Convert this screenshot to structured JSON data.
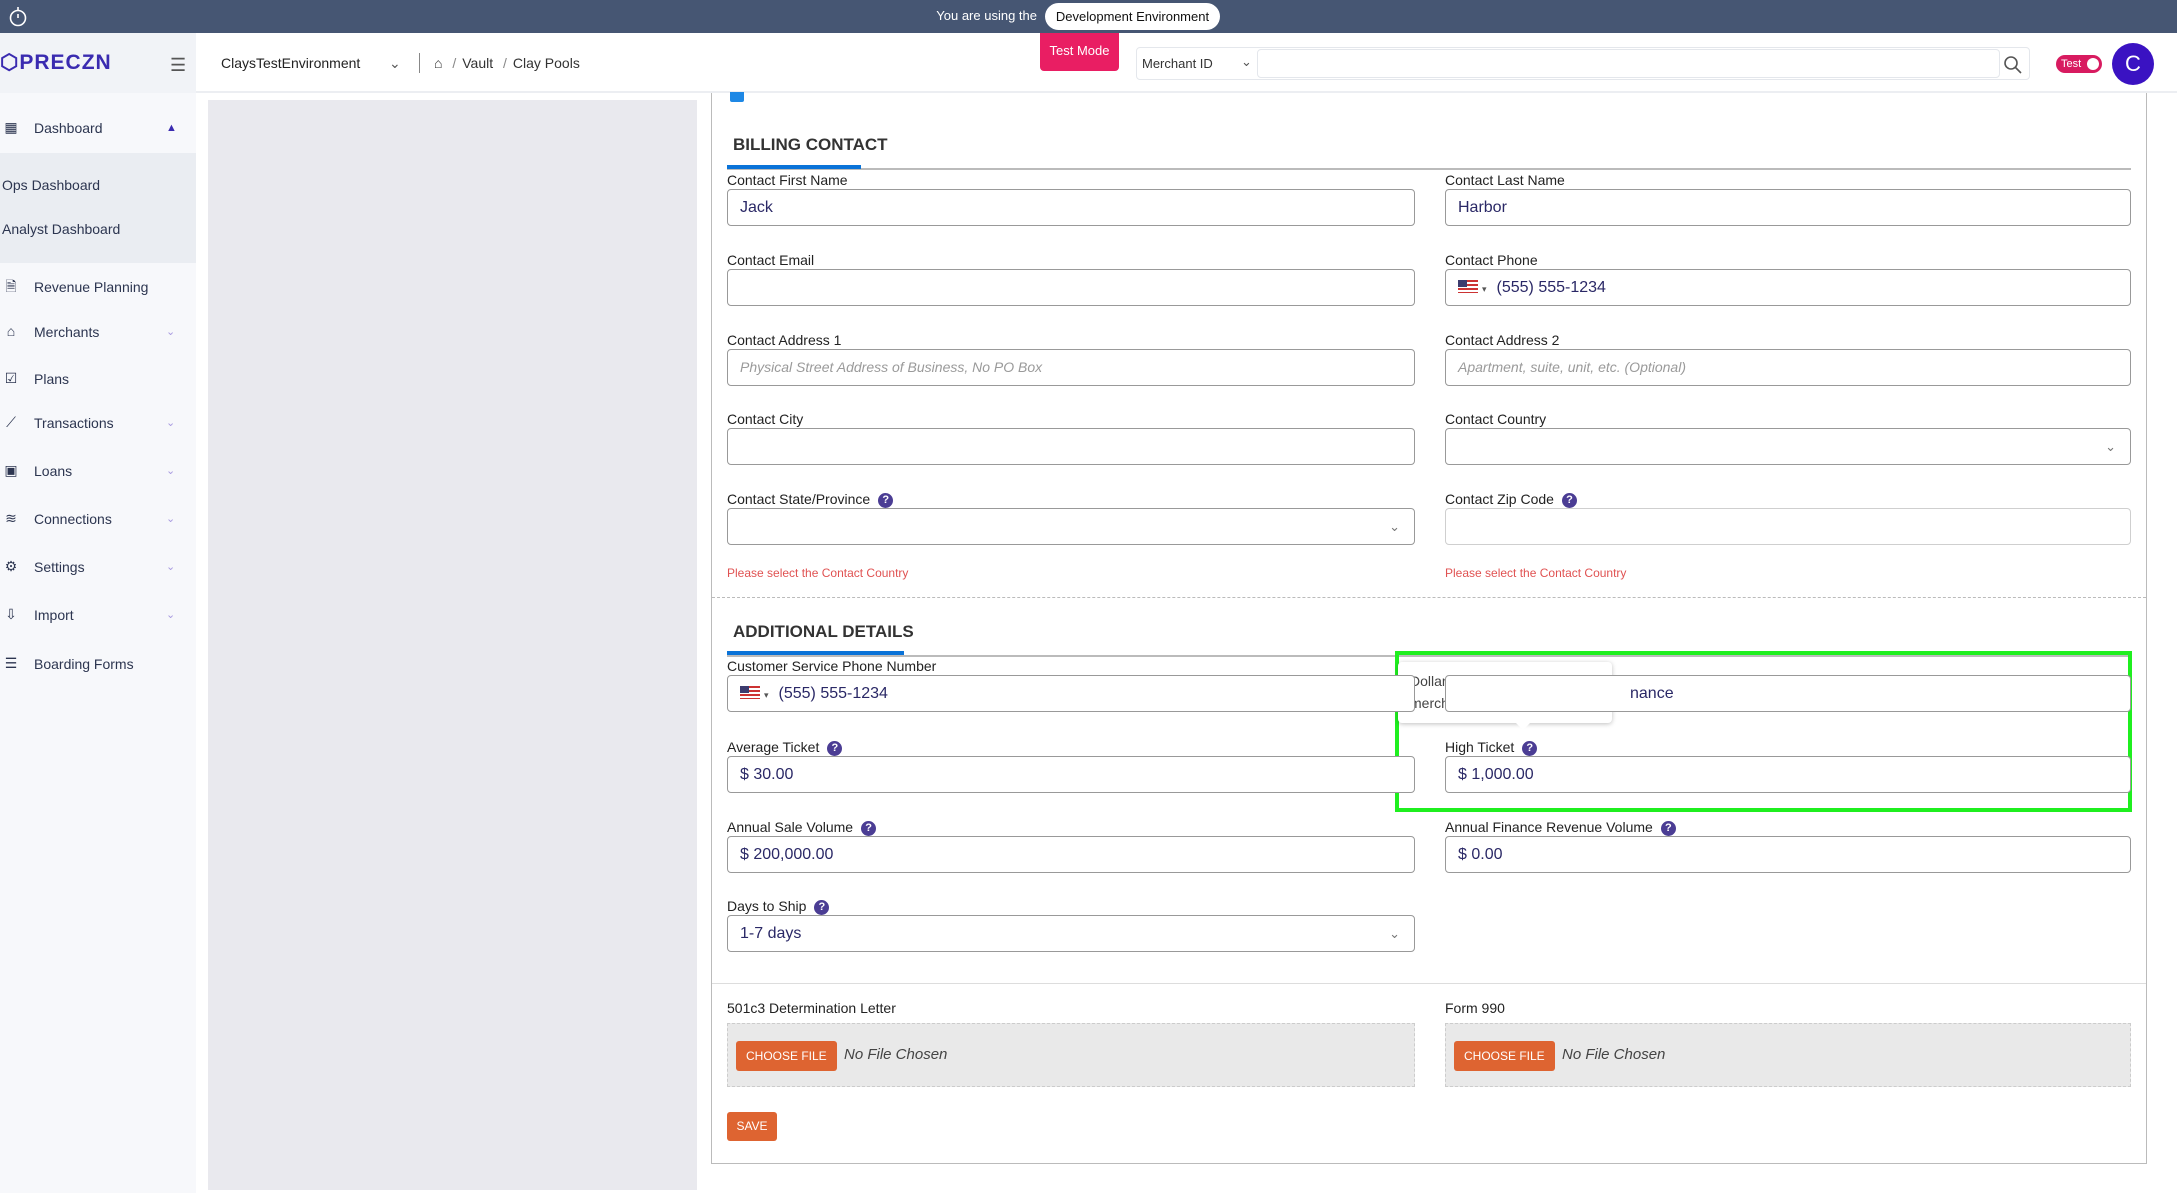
{
  "banner": {
    "text": "You are using the",
    "environment": "Development Environment"
  },
  "header": {
    "logo": "PRECZN",
    "environment_select": "ClaysTestEnvironment",
    "breadcrumb": [
      "Vault",
      "Clay Pools"
    ],
    "test_mode_badge": "Test Mode",
    "search_type": "Merchant ID",
    "search_value": "",
    "toggle_label": "Test",
    "avatar_initial": "C"
  },
  "sidebar": {
    "items": [
      {
        "label": "Dashboard",
        "icon": "layout-icon",
        "chevron": "up"
      },
      {
        "label": "Ops Dashboard"
      },
      {
        "label": "Analyst Dashboard"
      },
      {
        "label": "Revenue Planning",
        "icon": "invoice-icon"
      },
      {
        "label": "Merchants",
        "icon": "store-icon",
        "chevron": "down"
      },
      {
        "label": "Plans",
        "icon": "checklist-icon"
      },
      {
        "label": "Transactions",
        "icon": "chart-line-icon",
        "chevron": "down"
      },
      {
        "label": "Loans",
        "icon": "wallet-icon",
        "chevron": "down"
      },
      {
        "label": "Connections",
        "icon": "layers-icon",
        "chevron": "down"
      },
      {
        "label": "Settings",
        "icon": "gear-icon",
        "chevron": "down"
      },
      {
        "label": "Import",
        "icon": "import-icon",
        "chevron": "down"
      },
      {
        "label": "Boarding Forms",
        "icon": "forms-icon"
      }
    ]
  },
  "billing": {
    "title": "BILLING CONTACT",
    "fields": [
      {
        "label": "Contact First Name",
        "value": "Jack"
      },
      {
        "label": "Contact Last Name",
        "value": "Harbor"
      },
      {
        "label": "Contact Email",
        "value": ""
      },
      {
        "label": "Contact Phone",
        "value": "(555) 555-1234",
        "type": "phone"
      },
      {
        "label": "Contact Address 1",
        "placeholder": "Physical Street Address of Business, No PO Box"
      },
      {
        "label": "Contact Address 2",
        "placeholder": "Apartment, suite, unit, etc. (Optional)"
      },
      {
        "label": "Contact City",
        "value": ""
      },
      {
        "label": "Contact Country",
        "value": "",
        "type": "select"
      },
      {
        "label": "Contact State/Province",
        "value": "",
        "type": "select",
        "help": true,
        "error": "Please select the Contact Country"
      },
      {
        "label": "Contact Zip Code",
        "value": "",
        "help": true,
        "light": true,
        "error": "Please select the Contact Country"
      }
    ]
  },
  "additional": {
    "title": "ADDITIONAL DETAILS",
    "fields": [
      {
        "label": "Customer Service Phone Number",
        "value": "(555) 555-1234",
        "type": "phone"
      },
      {
        "label": "",
        "value": "nance",
        "type": "obscured"
      },
      {
        "label": "Average Ticket",
        "value": "$ 30.00",
        "help": true
      },
      {
        "label": "High Ticket",
        "value": "$ 1,000.00",
        "help": true
      },
      {
        "label": "Annual Sale Volume",
        "value": "$ 200,000.00",
        "help": true
      },
      {
        "label": "Annual Finance Revenue Volume",
        "value": "$ 0.00",
        "help": true
      },
      {
        "label": "Days to Ship",
        "value": "1-7 days",
        "type": "select",
        "help": true
      }
    ],
    "tooltip": "Dollar amount of this merchant’s highest transaction"
  },
  "uploads": [
    {
      "label": "501c3 Determination Letter",
      "button": "CHOOSE FILE",
      "status": "No File Chosen"
    },
    {
      "label": "Form 990",
      "button": "CHOOSE FILE",
      "status": "No File Chosen"
    }
  ],
  "save_label": "SAVE",
  "colors": {
    "accent": "#de6431",
    "highlight": "#1fef1f",
    "brand": "#3a2bb0",
    "test_mode": "#e91e63"
  }
}
